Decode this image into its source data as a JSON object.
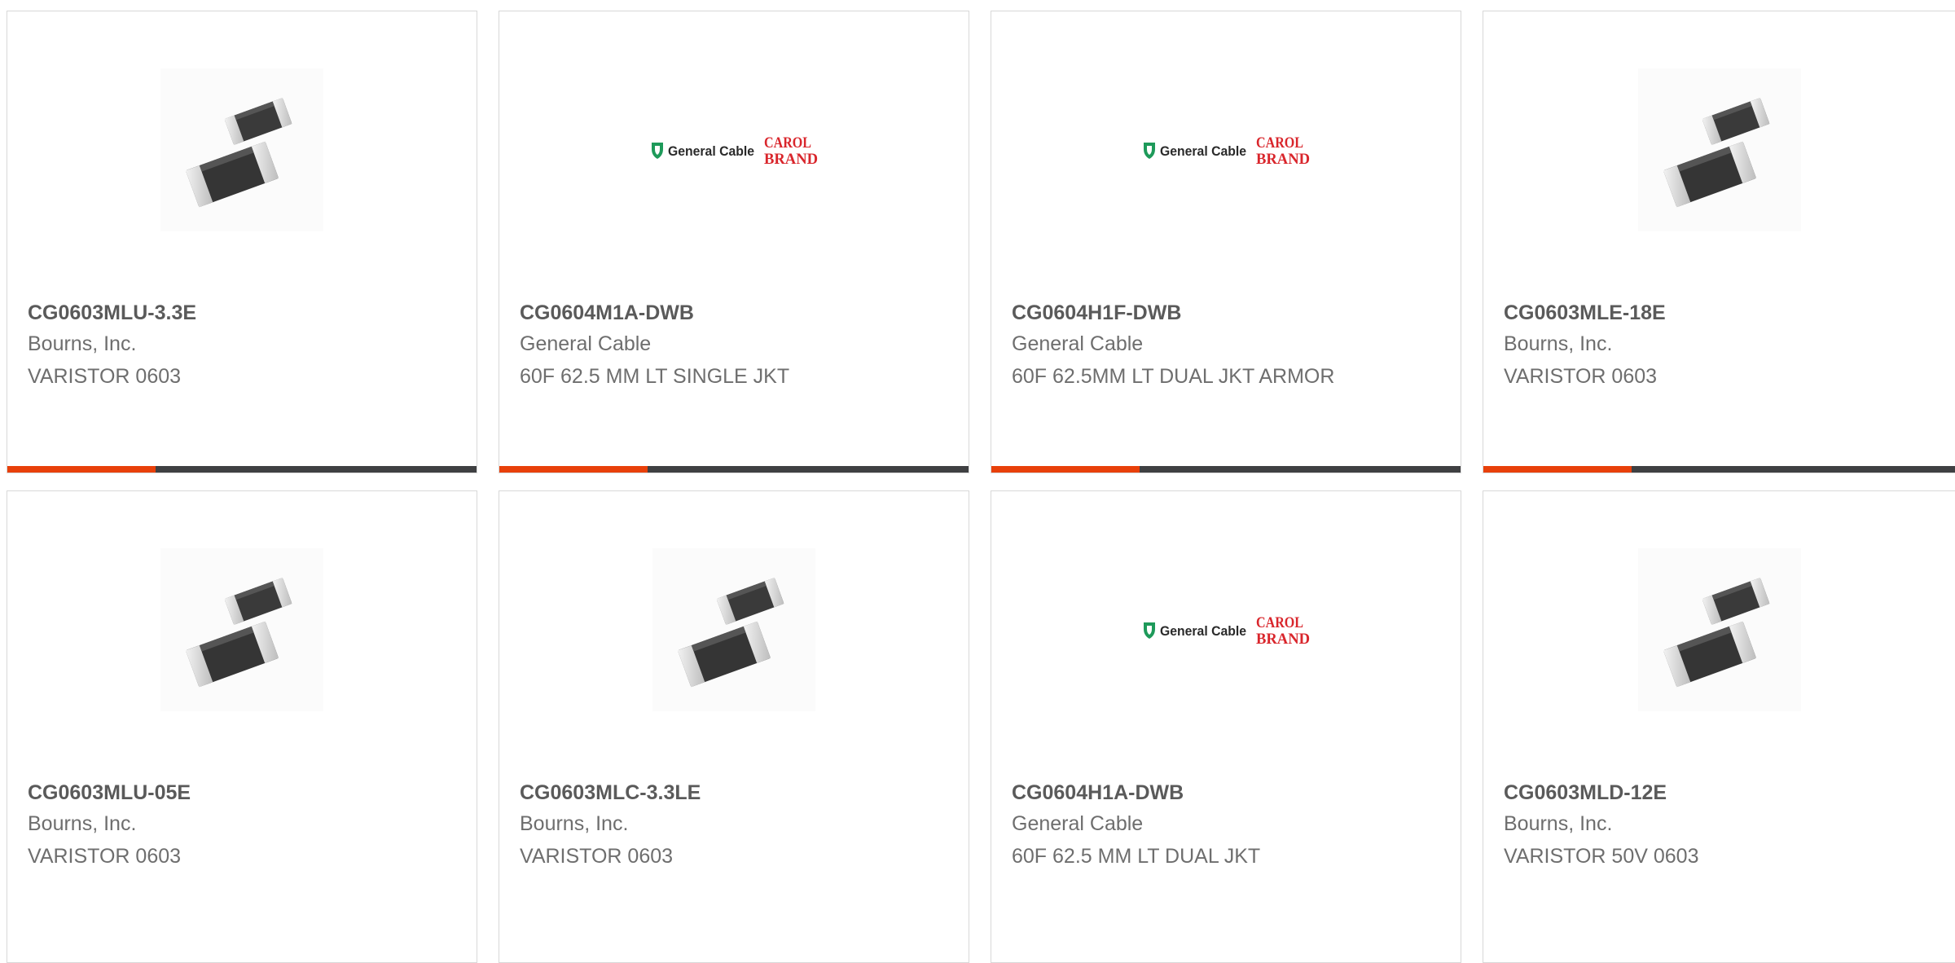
{
  "colors": {
    "accent": "#e8400a",
    "bar": "#3f4042",
    "border": "#d8d8d8",
    "text": "#5a5a5a"
  },
  "cards": [
    {
      "part_number": "CG0603MLU-3.3E",
      "manufacturer": "Bourns, Inc.",
      "description": "VARISTOR 0603",
      "image": "varistor-chip"
    },
    {
      "part_number": "CG0604M1A-DWB",
      "manufacturer": "General Cable",
      "description": "60F 62.5 MM LT SINGLE JKT",
      "image": "general-cable-logo"
    },
    {
      "part_number": "CG0604H1F-DWB",
      "manufacturer": "General Cable",
      "description": "60F 62.5MM LT DUAL JKT ARMOR",
      "image": "general-cable-logo"
    },
    {
      "part_number": "CG0603MLE-18E",
      "manufacturer": "Bourns, Inc.",
      "description": "VARISTOR 0603",
      "image": "varistor-chip"
    },
    {
      "part_number": "CG0603MLU-05E",
      "manufacturer": "Bourns, Inc.",
      "description": "VARISTOR 0603",
      "image": "varistor-chip"
    },
    {
      "part_number": "CG0603MLC-3.3LE",
      "manufacturer": "Bourns, Inc.",
      "description": "VARISTOR 0603",
      "image": "varistor-chip"
    },
    {
      "part_number": "CG0604H1A-DWB",
      "manufacturer": "General Cable",
      "description": "60F 62.5 MM LT DUAL JKT",
      "image": "general-cable-logo"
    },
    {
      "part_number": "CG0603MLD-12E",
      "manufacturer": "Bourns, Inc.",
      "description": "VARISTOR 50V 0603",
      "image": "varistor-chip"
    }
  ],
  "logo": {
    "company": "General Cable",
    "brand_line1": "CAROL",
    "brand_line2": "BRAND"
  }
}
